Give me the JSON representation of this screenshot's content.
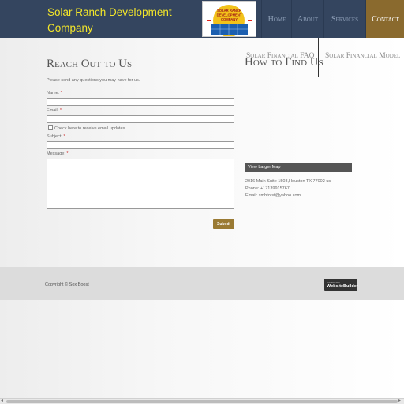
{
  "header": {
    "brand": "Solar Ranch Development Company",
    "logo_text": [
      "SOLAR RANCH",
      "DEVELOPMENT",
      "COMPANY"
    ]
  },
  "nav": {
    "items": [
      {
        "label": "Home"
      },
      {
        "label": "About"
      },
      {
        "label": "Services"
      },
      {
        "label": "Contact"
      }
    ],
    "sub_items": [
      {
        "label": "Solar Financial FAQ"
      },
      {
        "label": "Solar Financial Model"
      }
    ]
  },
  "contact": {
    "title": "Reach Out to Us",
    "intro": "Please send any questions you may have for us.",
    "name_label": "Name:",
    "email_label": "Email:",
    "checkbox_label": "Check here to receive email updates",
    "subject_label": "Subject:",
    "message_label": "Message:",
    "required_marker": "*",
    "submit_label": "Submit"
  },
  "location": {
    "title": "How to Find Us",
    "map_button": "View Larger Map",
    "address": "2016 Main Suite 1503,Houston TX 77002 us",
    "phone": "Phone: +17139915767",
    "email": "Email: smbtotst@yahoo.com"
  },
  "footer": {
    "copyright": "Copyright © Sox Boost",
    "badge_small": "Created with",
    "badge_big": "WebsiteBuilder"
  },
  "colors": {
    "header_bg": "#34455f",
    "brand_text": "#f3e62a",
    "active_nav": "#8a6a2e",
    "submit_bg": "#9a7a33"
  }
}
